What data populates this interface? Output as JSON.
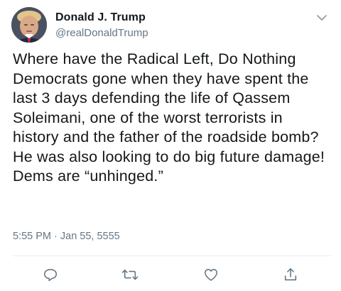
{
  "tweet": {
    "author": {
      "display_name": "Donald J. Trump",
      "username": "@realDonaldTrump",
      "avatar_icon": "profile-photo"
    },
    "text": "Where have the Radical Left, Do Nothing Democrats gone when they have spent the last 3 days defending the life of Qassem Soleimani, one of the worst terrorists in history and the father of the roadside bomb? He was also looking to do big future damage! Dems are “unhinged.”",
    "timestamp": "5:55 PM · Jan 55, 5555"
  },
  "actions": {
    "reply_icon": "reply-icon",
    "retweet_icon": "retweet-icon",
    "like_icon": "like-icon",
    "share_icon": "share-icon"
  },
  "colors": {
    "text_primary": "#14171a",
    "text_secondary": "#657786",
    "divider": "#e6ecf0",
    "icon": "#657786"
  }
}
